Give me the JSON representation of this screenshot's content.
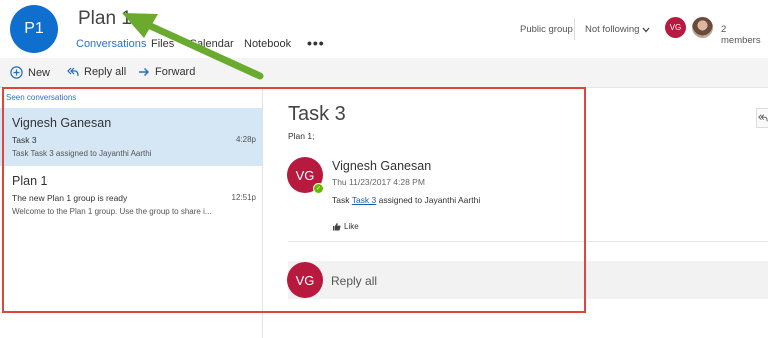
{
  "header": {
    "group_initials": "P1",
    "group_name": "Plan 1",
    "tabs": [
      "Conversations",
      "Files",
      "Calendar",
      "Notebook"
    ],
    "more": "•••",
    "public_group": "Public group",
    "following": "Not following",
    "member_initials": "VG",
    "members_count": "2 members"
  },
  "toolbar": {
    "new_label": "New",
    "reply_all_label": "Reply all",
    "forward_label": "Forward"
  },
  "list": {
    "seen_label": "Seen conversations",
    "conversations": [
      {
        "sender": "Vignesh Ganesan",
        "subject": "Task 3",
        "time": "4:28p",
        "preview": "Task Task 3 assigned to Jayanthi Aarthi"
      },
      {
        "sender": "Plan 1",
        "subject": "The new Plan 1 group is ready",
        "time": "12:51p",
        "preview": "Welcome to the Plan 1 group. Use the group to share i..."
      }
    ]
  },
  "reading": {
    "title": "Task 3",
    "subtitle": "Plan 1;",
    "sender_initials": "VG",
    "sender_name": "Vignesh Ganesan",
    "sent_time": "Thu 11/23/2017 4:28 PM",
    "body_prefix": "Task ",
    "body_link": "Task 3",
    "body_suffix": " assigned to Jayanthi Aarthi",
    "like_label": "Like",
    "reply_initials": "VG",
    "reply_label": "Reply all"
  },
  "colors": {
    "accent": "#2b73c6",
    "avatar_group": "#0f6fcf",
    "avatar_user": "#b8193f",
    "selected_row": "#d5e6f5",
    "annotation_box": "#e0453a",
    "annotation_arrow": "#6aaa2f"
  },
  "icons": [
    "plus-circle-icon",
    "reply-all-icon",
    "forward-arrow-icon",
    "chevron-down-icon",
    "thumbs-up-icon",
    "presence-available-icon",
    "reply-all-icon",
    "annotation-arrow"
  ]
}
